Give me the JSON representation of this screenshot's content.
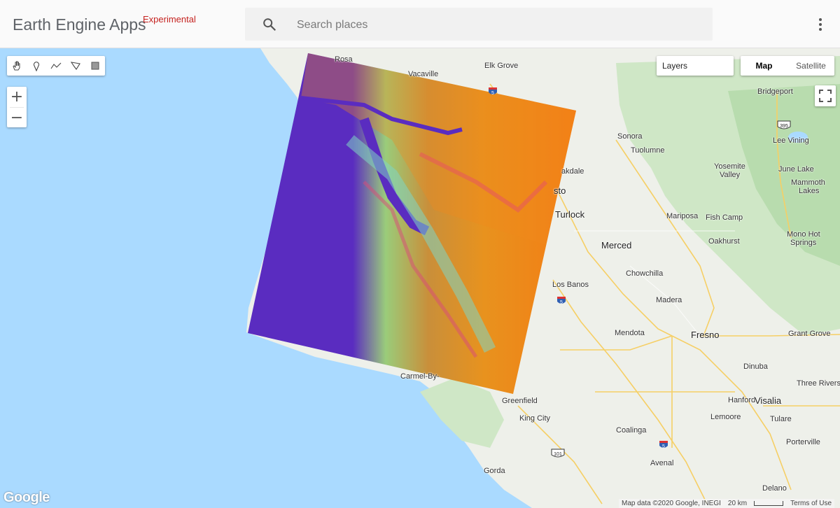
{
  "header": {
    "title": "Earth Engine Apps",
    "badge": "Experimental",
    "search_placeholder": "Search places"
  },
  "map_controls": {
    "layers_label": "Layers",
    "map_types": [
      "Map",
      "Satellite"
    ],
    "active_map_type": "Map",
    "zoom_in": "+",
    "zoom_out": "−",
    "drawing_tools": [
      "pan-hand-icon",
      "point-marker-icon",
      "line-draw-icon",
      "polygon-draw-icon",
      "rectangle-draw-icon"
    ]
  },
  "cities": [
    {
      "name": "Rosa",
      "major": false
    },
    {
      "name": "Vacaville",
      "major": false
    },
    {
      "name": "Elk Grove",
      "major": false
    },
    {
      "name": "Bridgeport",
      "major": false
    },
    {
      "name": "Sonora",
      "major": false
    },
    {
      "name": "Tuolumne",
      "major": false
    },
    {
      "name": "Lee Vining",
      "major": false
    },
    {
      "name": "Yosemite",
      "major": false
    },
    {
      "name": "Valley",
      "major": false
    },
    {
      "name": "June Lake",
      "major": false
    },
    {
      "name": "Mammoth",
      "major": false
    },
    {
      "name": "Lakes",
      "major": false
    },
    {
      "name": "akdale",
      "major": false
    },
    {
      "name": "sto",
      "major": true
    },
    {
      "name": "Turlock",
      "major": true
    },
    {
      "name": "Mariposa",
      "major": false
    },
    {
      "name": "Fish Camp",
      "major": false
    },
    {
      "name": "Mono Hot",
      "major": false
    },
    {
      "name": "Springs",
      "major": false
    },
    {
      "name": "Oakhurst",
      "major": false
    },
    {
      "name": "Merced",
      "major": true
    },
    {
      "name": "Chowchilla",
      "major": false
    },
    {
      "name": "Los Banos",
      "major": false
    },
    {
      "name": "Madera",
      "major": false
    },
    {
      "name": "Mendota",
      "major": false
    },
    {
      "name": "Fresno",
      "major": true
    },
    {
      "name": "Grant Grove",
      "major": false
    },
    {
      "name": "Dinuba",
      "major": false
    },
    {
      "name": "Three Rivers",
      "major": false
    },
    {
      "name": "Carmel-By-",
      "major": false
    },
    {
      "name": "Greenfield",
      "major": false
    },
    {
      "name": "Hanford",
      "major": false
    },
    {
      "name": "Visalia",
      "major": true
    },
    {
      "name": "King City",
      "major": false
    },
    {
      "name": "Lemoore",
      "major": false
    },
    {
      "name": "Tulare",
      "major": false
    },
    {
      "name": "Coalinga",
      "major": false
    },
    {
      "name": "Porterville",
      "major": false
    },
    {
      "name": "Avenal",
      "major": false
    },
    {
      "name": "Gorda",
      "major": false
    },
    {
      "name": "Delano",
      "major": false
    }
  ],
  "highway_shields": [
    "5",
    "395",
    "5",
    "101",
    "5"
  ],
  "footer": {
    "google_logo": "Google",
    "map_data": "Map data ©2020 Google, INEGI",
    "scale": "20 km",
    "terms": "Terms of Use"
  }
}
